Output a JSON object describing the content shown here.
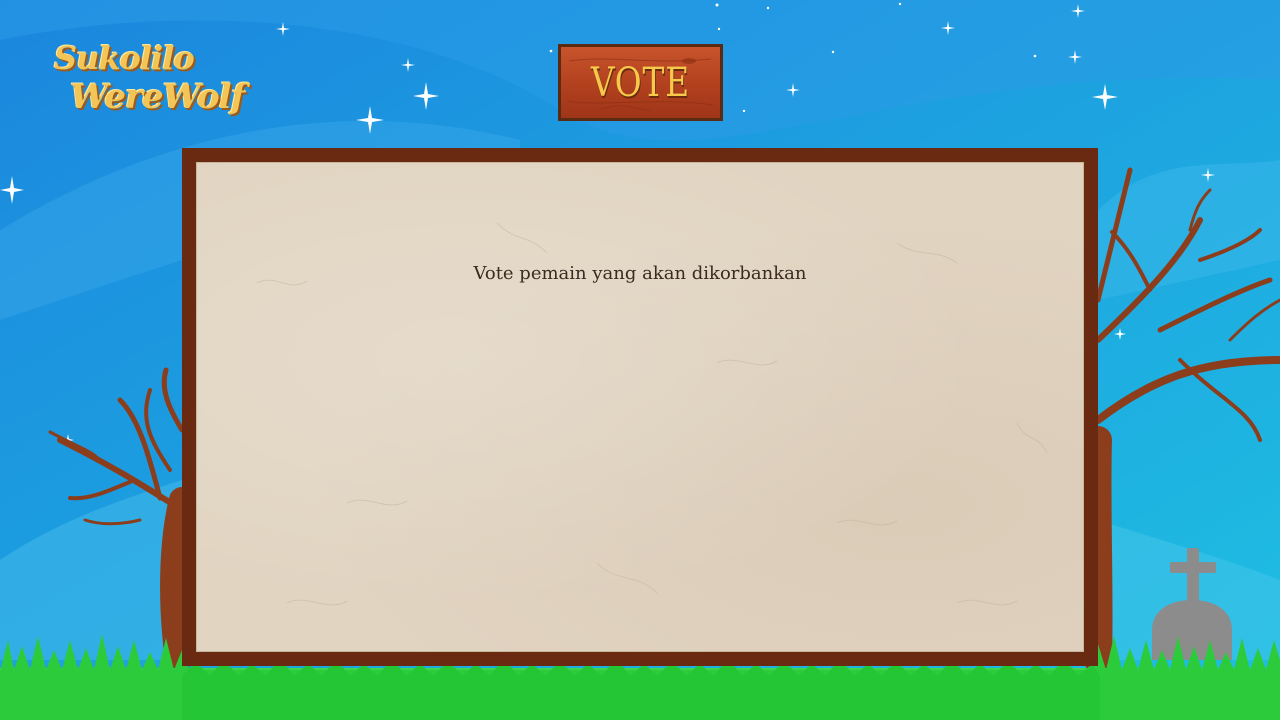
{
  "game": {
    "logo_line1": "Sukolilo",
    "logo_line2": "WereWolf"
  },
  "header": {
    "sign_label": "VOTE"
  },
  "board": {
    "instruction": "Vote pemain yang akan dikorbankan"
  },
  "colors": {
    "sky_top": "#1b8fe0",
    "sky_bottom": "#29c3e6",
    "grass": "#22c23a",
    "board_frame": "#6a2a11",
    "paper": "#e1d4c1",
    "sign_wood": "#b3421f",
    "sign_text": "#f6c94b",
    "tree": "#8b3d1c",
    "tombstone": "#8c8c8c"
  },
  "icons": {
    "stars": "sparkle-star",
    "tombstone": "cross-tombstone"
  }
}
